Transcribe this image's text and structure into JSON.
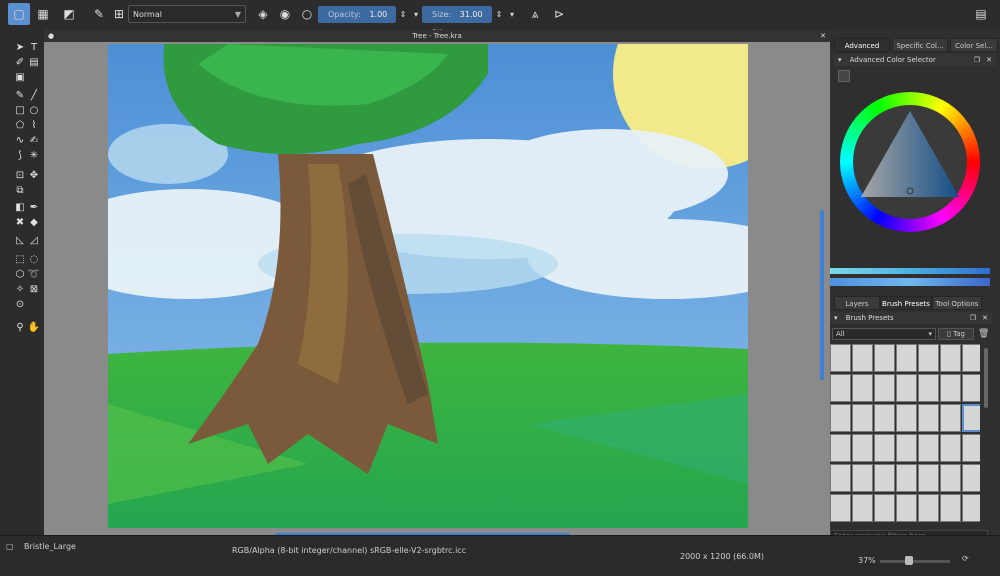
{
  "toolbar": {
    "blend_mode": "Normal",
    "opacity_label": "Opacity:",
    "opacity_value": "1.00",
    "size_label": "Size:",
    "size_value": "31.00 px"
  },
  "document": {
    "tab_title": "Tree - Tree.kra"
  },
  "right_dock": {
    "top_tabs": [
      "Advanced Col...",
      "Specific Col...",
      "Color Sel..."
    ],
    "color_selector_title": "Advanced Color Selector",
    "bottom_tabs": [
      "Layers",
      "Brush Presets",
      "Tool Options"
    ],
    "brush_presets_title": "Brush Presets",
    "preset_filter": "All",
    "tag_label": "Tag",
    "search_placeholder": "Enter resource filters here"
  },
  "status": {
    "brush_name": "Bristle_Large",
    "color_profile": "RGB/Alpha (8-bit integer/channel) sRGB-elle-V2-srgbtrc.icc",
    "dimensions": "2000 x 1200 (66.0M)",
    "zoom": "37%"
  },
  "colors": {
    "accent": "#5a8fd0",
    "panel": "#2f2f2f",
    "toolbar": "#2c2c2c"
  }
}
